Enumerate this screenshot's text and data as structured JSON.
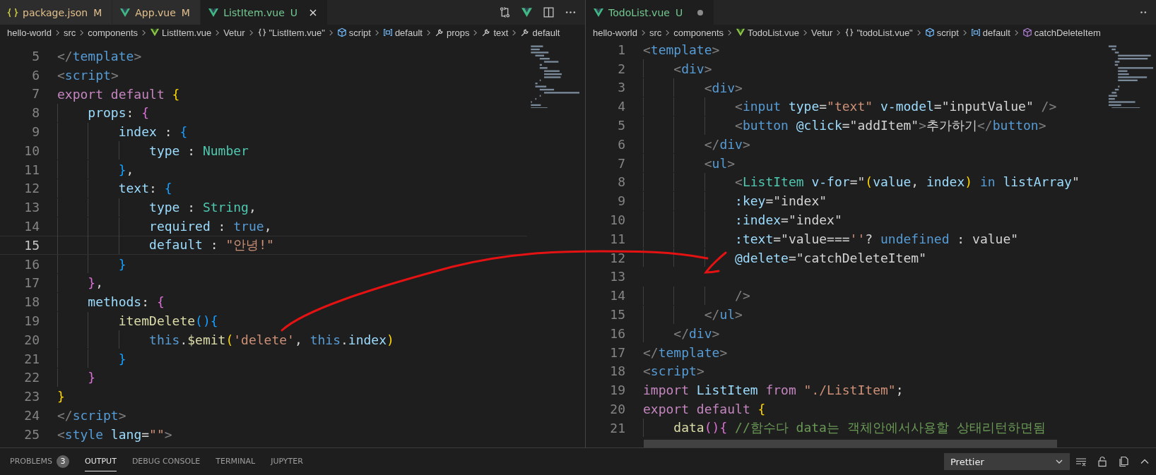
{
  "editors": [
    {
      "tabs": [
        {
          "label": "package.json",
          "kind": "json",
          "status": "M",
          "selected": false,
          "dirty": false
        },
        {
          "label": "App.vue",
          "kind": "vue",
          "status": "M",
          "selected": false,
          "dirty": false
        },
        {
          "label": "ListItem.vue",
          "kind": "vue",
          "status": "U",
          "selected": true,
          "dirty": false
        }
      ],
      "breadcrumbs": [
        {
          "text": "hello-world",
          "kind": "folder"
        },
        {
          "text": "src",
          "kind": "folder"
        },
        {
          "text": "components",
          "kind": "folder"
        },
        {
          "text": "ListItem.vue",
          "kind": "vue"
        },
        {
          "text": "Vetur",
          "kind": "folder"
        },
        {
          "text": "\"ListItem.vue\"",
          "kind": "braces"
        },
        {
          "text": "script",
          "kind": "cube"
        },
        {
          "text": "default",
          "kind": "field"
        },
        {
          "text": "props",
          "kind": "wrench"
        },
        {
          "text": "text",
          "kind": "wrench"
        },
        {
          "text": "default",
          "kind": "wrench"
        }
      ],
      "lines": [
        {
          "number": "5",
          "current": false,
          "tokens": [
            {
              "kind": "p",
              "text": "</"
            },
            {
              "kind": "tag",
              "text": "template"
            },
            {
              "kind": "p",
              "text": ">"
            }
          ]
        },
        {
          "number": "6",
          "current": false,
          "tokens": [
            {
              "kind": "p",
              "text": "<"
            },
            {
              "kind": "tag",
              "text": "script"
            },
            {
              "kind": "p",
              "text": ">"
            }
          ]
        },
        {
          "number": "7",
          "current": false,
          "tokens": [
            {
              "kind": "kw",
              "text": "export default "
            },
            {
              "kind": "b1",
              "text": "{"
            }
          ]
        },
        {
          "number": "8",
          "current": false,
          "tokens": [
            {
              "kind": "prop",
              "text": "    props"
            },
            {
              "kind": "plain",
              "text": ": "
            },
            {
              "kind": "b2",
              "text": "{"
            }
          ]
        },
        {
          "number": "9",
          "current": false,
          "tokens": [
            {
              "kind": "prop",
              "text": "        index"
            },
            {
              "kind": "plain",
              "text": " : "
            },
            {
              "kind": "b3",
              "text": "{"
            }
          ]
        },
        {
          "number": "10",
          "current": false,
          "tokens": [
            {
              "kind": "prop",
              "text": "            type"
            },
            {
              "kind": "plain",
              "text": " : "
            },
            {
              "kind": "type",
              "text": "Number"
            }
          ]
        },
        {
          "number": "11",
          "current": false,
          "tokens": [
            {
              "kind": "b3",
              "text": "        }"
            },
            {
              "kind": "plain",
              "text": ","
            }
          ]
        },
        {
          "number": "12",
          "current": false,
          "tokens": [
            {
              "kind": "prop",
              "text": "        text"
            },
            {
              "kind": "plain",
              "text": ": "
            },
            {
              "kind": "b3",
              "text": "{"
            }
          ]
        },
        {
          "number": "13",
          "current": false,
          "tokens": [
            {
              "kind": "prop",
              "text": "            type"
            },
            {
              "kind": "plain",
              "text": " : "
            },
            {
              "kind": "type",
              "text": "String"
            },
            {
              "kind": "plain",
              "text": ","
            }
          ]
        },
        {
          "number": "14",
          "current": false,
          "tokens": [
            {
              "kind": "prop",
              "text": "            required"
            },
            {
              "kind": "plain",
              "text": " : "
            },
            {
              "kind": "blue",
              "text": "true"
            },
            {
              "kind": "plain",
              "text": ","
            }
          ]
        },
        {
          "number": "15",
          "current": true,
          "tokens": [
            {
              "kind": "prop",
              "text": "            default"
            },
            {
              "kind": "plain",
              "text": " : "
            },
            {
              "kind": "str",
              "text": "\"안녕!\""
            }
          ]
        },
        {
          "number": "16",
          "current": false,
          "tokens": [
            {
              "kind": "b3",
              "text": "        }"
            }
          ]
        },
        {
          "number": "17",
          "current": false,
          "tokens": [
            {
              "kind": "b2",
              "text": "    }"
            },
            {
              "kind": "plain",
              "text": ","
            }
          ]
        },
        {
          "number": "18",
          "current": false,
          "tokens": [
            {
              "kind": "prop",
              "text": "    methods"
            },
            {
              "kind": "plain",
              "text": ": "
            },
            {
              "kind": "b2",
              "text": "{"
            }
          ]
        },
        {
          "number": "19",
          "current": false,
          "tokens": [
            {
              "kind": "func",
              "text": "        itemDelete"
            },
            {
              "kind": "b3",
              "text": "(){"
            }
          ]
        },
        {
          "number": "20",
          "current": false,
          "tokens": [
            {
              "kind": "blue",
              "text": "            this"
            },
            {
              "kind": "plain",
              "text": "."
            },
            {
              "kind": "func",
              "text": "$emit"
            },
            {
              "kind": "b1",
              "text": "("
            },
            {
              "kind": "str",
              "text": "'delete'"
            },
            {
              "kind": "plain",
              "text": ", "
            },
            {
              "kind": "blue",
              "text": "this"
            },
            {
              "kind": "plain",
              "text": "."
            },
            {
              "kind": "prop",
              "text": "index"
            },
            {
              "kind": "b1",
              "text": ")"
            }
          ]
        },
        {
          "number": "21",
          "current": false,
          "tokens": [
            {
              "kind": "b3",
              "text": "        }"
            }
          ]
        },
        {
          "number": "22",
          "current": false,
          "tokens": [
            {
              "kind": "b2",
              "text": "    }"
            }
          ]
        },
        {
          "number": "23",
          "current": false,
          "tokens": [
            {
              "kind": "b1",
              "text": "}"
            }
          ]
        },
        {
          "number": "24",
          "current": false,
          "tokens": [
            {
              "kind": "p",
              "text": "</"
            },
            {
              "kind": "tag",
              "text": "script"
            },
            {
              "kind": "p",
              "text": ">"
            }
          ]
        },
        {
          "number": "25",
          "current": false,
          "tokens": [
            {
              "kind": "p",
              "text": "<"
            },
            {
              "kind": "tag",
              "text": "style"
            },
            {
              "kind": "attr",
              "text": " lang"
            },
            {
              "kind": "plain",
              "text": "="
            },
            {
              "kind": "str",
              "text": "\"\""
            },
            {
              "kind": "p",
              "text": ">"
            }
          ]
        }
      ]
    },
    {
      "tabs": [
        {
          "label": "TodoList.vue",
          "kind": "vue",
          "status": "U",
          "selected": true,
          "dirty": true
        }
      ],
      "breadcrumbs": [
        {
          "text": "hello-world",
          "kind": "folder"
        },
        {
          "text": "src",
          "kind": "folder"
        },
        {
          "text": "components",
          "kind": "folder"
        },
        {
          "text": "TodoList.vue",
          "kind": "vue"
        },
        {
          "text": "Vetur",
          "kind": "folder"
        },
        {
          "text": "\"todoList.vue\"",
          "kind": "braces"
        },
        {
          "text": "script",
          "kind": "cube"
        },
        {
          "text": "default",
          "kind": "field"
        },
        {
          "text": "catchDeleteItem",
          "kind": "method"
        }
      ],
      "lines": [
        {
          "number": "1",
          "current": false,
          "tokens": [
            {
              "kind": "p",
              "text": "<"
            },
            {
              "kind": "tag",
              "text": "template"
            },
            {
              "kind": "p",
              "text": ">"
            }
          ]
        },
        {
          "number": "2",
          "current": false,
          "tokens": [
            {
              "kind": "p",
              "text": "    <"
            },
            {
              "kind": "tag",
              "text": "div"
            },
            {
              "kind": "p",
              "text": ">"
            }
          ]
        },
        {
          "number": "3",
          "current": false,
          "tokens": [
            {
              "kind": "p",
              "text": "        <"
            },
            {
              "kind": "tag",
              "text": "div"
            },
            {
              "kind": "p",
              "text": ">"
            }
          ]
        },
        {
          "number": "4",
          "current": false,
          "tokens": [
            {
              "kind": "p",
              "text": "            <"
            },
            {
              "kind": "tag",
              "text": "input"
            },
            {
              "kind": "attr",
              "text": " type"
            },
            {
              "kind": "plain",
              "text": "="
            },
            {
              "kind": "str",
              "text": "\"text\""
            },
            {
              "kind": "attr",
              "text": " v-model"
            },
            {
              "kind": "plain",
              "text": "=\"inputValue\""
            },
            {
              "kind": "p",
              "text": " />"
            }
          ]
        },
        {
          "number": "5",
          "current": false,
          "tokens": [
            {
              "kind": "p",
              "text": "            <"
            },
            {
              "kind": "tag",
              "text": "button"
            },
            {
              "kind": "attr",
              "text": " @click"
            },
            {
              "kind": "plain",
              "text": "=\"addItem\""
            },
            {
              "kind": "p",
              "text": ">"
            },
            {
              "kind": "plain",
              "text": "추가하기"
            },
            {
              "kind": "p",
              "text": "</"
            },
            {
              "kind": "tag",
              "text": "button"
            },
            {
              "kind": "p",
              "text": ">"
            }
          ]
        },
        {
          "number": "6",
          "current": false,
          "tokens": [
            {
              "kind": "p",
              "text": "        </"
            },
            {
              "kind": "tag",
              "text": "div"
            },
            {
              "kind": "p",
              "text": ">"
            }
          ]
        },
        {
          "number": "7",
          "current": false,
          "tokens": [
            {
              "kind": "p",
              "text": "        <"
            },
            {
              "kind": "tag",
              "text": "ul"
            },
            {
              "kind": "p",
              "text": ">"
            }
          ]
        },
        {
          "number": "8",
          "current": false,
          "tokens": [
            {
              "kind": "p",
              "text": "            <"
            },
            {
              "kind": "comp",
              "text": "ListItem"
            },
            {
              "kind": "attr",
              "text": " v-for"
            },
            {
              "kind": "plain",
              "text": "=\""
            },
            {
              "kind": "b1",
              "text": "("
            },
            {
              "kind": "prop",
              "text": "value"
            },
            {
              "kind": "plain",
              "text": ", "
            },
            {
              "kind": "prop",
              "text": "index"
            },
            {
              "kind": "b1",
              "text": ")"
            },
            {
              "kind": "blue",
              "text": " in "
            },
            {
              "kind": "prop",
              "text": "listArray"
            },
            {
              "kind": "plain",
              "text": "\""
            }
          ]
        },
        {
          "number": "9",
          "current": false,
          "tokens": [
            {
              "kind": "attr",
              "text": "            :key"
            },
            {
              "kind": "plain",
              "text": "=\"index\""
            }
          ]
        },
        {
          "number": "10",
          "current": false,
          "tokens": [
            {
              "kind": "attr",
              "text": "            :index"
            },
            {
              "kind": "plain",
              "text": "=\"index\""
            }
          ]
        },
        {
          "number": "11",
          "current": false,
          "tokens": [
            {
              "kind": "attr",
              "text": "            :text"
            },
            {
              "kind": "plain",
              "text": "=\"value==="
            },
            {
              "kind": "str",
              "text": "''"
            },
            {
              "kind": "plain",
              "text": "? "
            },
            {
              "kind": "blue",
              "text": "undefined"
            },
            {
              "kind": "plain",
              "text": " : value\""
            }
          ]
        },
        {
          "number": "12",
          "current": false,
          "tokens": [
            {
              "kind": "attr",
              "text": "            @delete"
            },
            {
              "kind": "plain",
              "text": "=\"catchDeleteItem\""
            }
          ]
        },
        {
          "number": "13",
          "current": false
        },
        {
          "number": "14",
          "current": false,
          "tokens": [
            {
              "kind": "p",
              "text": "            />"
            }
          ]
        },
        {
          "number": "15",
          "current": false,
          "tokens": [
            {
              "kind": "p",
              "text": "        </"
            },
            {
              "kind": "tag",
              "text": "ul"
            },
            {
              "kind": "p",
              "text": ">"
            }
          ]
        },
        {
          "number": "16",
          "current": false,
          "tokens": [
            {
              "kind": "p",
              "text": "    </"
            },
            {
              "kind": "tag",
              "text": "div"
            },
            {
              "kind": "p",
              "text": ">"
            }
          ]
        },
        {
          "number": "17",
          "current": false,
          "tokens": [
            {
              "kind": "p",
              "text": "</"
            },
            {
              "kind": "tag",
              "text": "template"
            },
            {
              "kind": "p",
              "text": ">"
            }
          ]
        },
        {
          "number": "18",
          "current": false,
          "tokens": [
            {
              "kind": "p",
              "text": "<"
            },
            {
              "kind": "tag",
              "text": "script"
            },
            {
              "kind": "p",
              "text": ">"
            }
          ]
        },
        {
          "number": "19",
          "current": false,
          "tokens": [
            {
              "kind": "kw",
              "text": "import"
            },
            {
              "kind": "prop",
              "text": " ListItem "
            },
            {
              "kind": "kw",
              "text": "from "
            },
            {
              "kind": "str",
              "text": "\"./ListItem\""
            },
            {
              "kind": "plain",
              "text": ";"
            }
          ]
        },
        {
          "number": "20",
          "current": false,
          "tokens": [
            {
              "kind": "kw",
              "text": "export default "
            },
            {
              "kind": "b1",
              "text": "{"
            }
          ]
        },
        {
          "number": "21",
          "current": false,
          "tokens": [
            {
              "kind": "func",
              "text": "    data"
            },
            {
              "kind": "b2",
              "text": "(){"
            },
            {
              "kind": "comment",
              "text": " //함수다 data는 객체안에서사용할 상태리턴하면됨"
            }
          ]
        }
      ]
    }
  ],
  "panel": {
    "tabs": [
      {
        "label": "PROBLEMS",
        "badge": "3",
        "selected": false
      },
      {
        "label": "OUTPUT",
        "selected": true
      },
      {
        "label": "DEBUG CONSOLE",
        "selected": false
      },
      {
        "label": "TERMINAL",
        "selected": false
      },
      {
        "label": "JUPYTER",
        "selected": false
      }
    ],
    "output_channel": "Prettier"
  }
}
